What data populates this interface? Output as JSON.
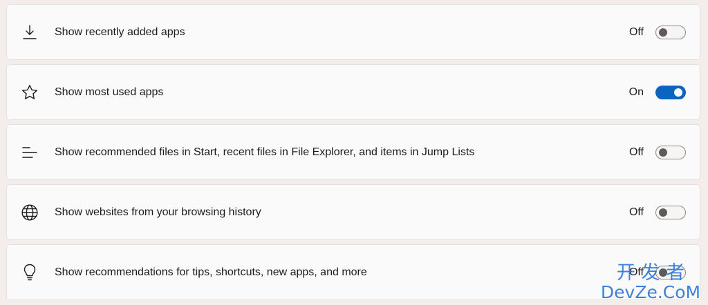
{
  "settings": {
    "rows": [
      {
        "icon": "download-icon",
        "label": "Show recently added apps",
        "state_label": "Off",
        "enabled": false
      },
      {
        "icon": "star-icon",
        "label": "Show most used apps",
        "state_label": "On",
        "enabled": true
      },
      {
        "icon": "list-lines-icon",
        "label": "Show recommended files in Start, recent files in File Explorer, and items in Jump Lists",
        "state_label": "Off",
        "enabled": false
      },
      {
        "icon": "globe-icon",
        "label": "Show websites from your browsing history",
        "state_label": "Off",
        "enabled": false
      },
      {
        "icon": "lightbulb-icon",
        "label": "Show recommendations for tips, shortcuts, new apps, and more",
        "state_label": "Off",
        "enabled": false
      }
    ]
  },
  "colors": {
    "accent": "#0a64c0",
    "row_background": "#fbfafa",
    "page_background": "#f3eeec",
    "watermark": "#1c6bd6"
  },
  "watermark": {
    "line1": "开 发 者",
    "line2": "DevZe.CoM"
  }
}
